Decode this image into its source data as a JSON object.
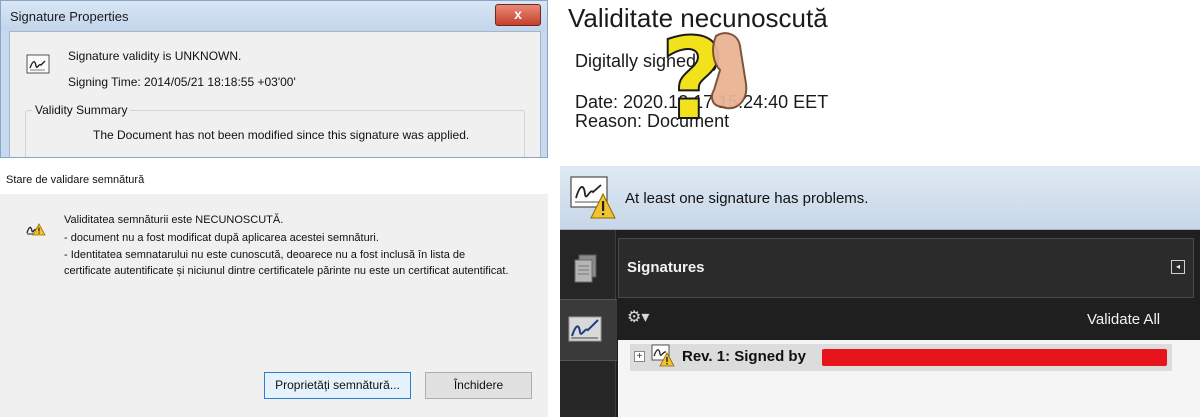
{
  "signature_properties": {
    "title": "Signature Properties",
    "close_glyph": "x",
    "status": "Signature validity is UNKNOWN.",
    "signing_time": "Signing Time:  2014/05/21 18:18:55 +03'00'",
    "summary_label": "Validity Summary",
    "summary_text": "The Document has not been modified since this signature was applied."
  },
  "validation_dialog": {
    "title": "Stare de validare semnătură",
    "lines": [
      "Validitatea semnăturii este NECUNOSCUTĂ.",
      "- document nu a fost modificat după aplicarea acestei semnături.",
      "- Identitatea semnatarului nu este cunoscută, deoarece nu a fost inclusă în lista de",
      "certificate autentificate și niciunul dintre certificatele părinte nu este un certificat autentificat."
    ],
    "buttons": {
      "properties": "Proprietăți semnătură...",
      "close": "Închidere"
    }
  },
  "validity_graphic": {
    "headline": "Validitate necunoscută",
    "signed_by": "Digitally signed by",
    "date": "Date: 2020.12.17 15:24:40 EET",
    "reason": "Reason: Document",
    "question_glyph": "?"
  },
  "signatures_pane": {
    "banner": "At least one signature has problems.",
    "header_title": "Signatures",
    "collapse_glyph": "◂",
    "options_glyph": "⚙▾",
    "validate_all": "Validate All",
    "expander_glyph": "+",
    "row_label": "Rev. 1: Signed by",
    "colors": {
      "warning": "#f2c230",
      "redaction": "#e8141b",
      "dark_bg": "#1f1f1f"
    }
  },
  "icons": [
    "signature-pen-icon",
    "warning-triangle-icon",
    "pages-icon",
    "gear-icon",
    "question-mark-icon",
    "close-icon"
  ]
}
